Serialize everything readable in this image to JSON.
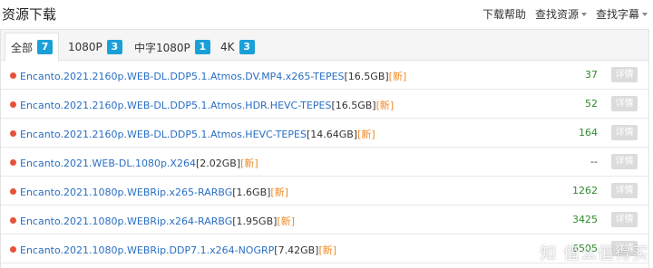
{
  "header": {
    "title": "资源下载",
    "actions": [
      {
        "label": "下载帮助",
        "dropdown": false
      },
      {
        "label": "查找资源",
        "dropdown": true
      },
      {
        "label": "查找字幕",
        "dropdown": true
      }
    ]
  },
  "tabs": [
    {
      "label": "全部",
      "count": "7",
      "active": true
    },
    {
      "label": "1080P",
      "count": "3",
      "active": false
    },
    {
      "label": "中字1080P",
      "count": "1",
      "active": false
    },
    {
      "label": "4K",
      "count": "3",
      "active": false
    }
  ],
  "rows": [
    {
      "name": "Encanto.2021.2160p.WEB-DL.DDP5.1.Atmos.DV.MP4.x265-TEPES",
      "size": "[16.5GB]",
      "tag": "[新]",
      "count": "37",
      "action": "详情"
    },
    {
      "name": "Encanto.2021.2160p.WEB-DL.DDP5.1.Atmos.HDR.HEVC-TEPES",
      "size": "[16.5GB]",
      "tag": "[新]",
      "count": "52",
      "action": "详情"
    },
    {
      "name": "Encanto.2021.2160p.WEB-DL.DDP5.1.Atmos.HEVC-TEPES",
      "size": "[14.64GB]",
      "tag": "[新]",
      "count": "164",
      "action": "详情"
    },
    {
      "name": "Encanto.2021.WEB-DL.1080p.X264",
      "size": "[2.02GB]",
      "tag": "[新]",
      "count": "--",
      "action": "详情"
    },
    {
      "name": "Encanto.2021.1080p.WEBRip.x265-RARBG",
      "size": "[1.6GB]",
      "tag": "[新]",
      "count": "1262",
      "action": "详情"
    },
    {
      "name": "Encanto.2021.1080p.WEBRip.x264-RARBG",
      "size": "[1.95GB]",
      "tag": "[新]",
      "count": "3425",
      "action": "详情"
    },
    {
      "name": "Encanto.2021.1080p.WEBRip.DDP7.1.x264-NOGRP",
      "size": "[7.42GB]",
      "tag": "[新]",
      "count": "6505",
      "action": "详情"
    }
  ],
  "watermark": "知 值么值得买",
  "colors": {
    "link": "#2a6fc4",
    "badge": "#1aa0d8",
    "new_tag": "#f08a24",
    "count": "#2e8b2e",
    "dot": "#e5523a"
  }
}
